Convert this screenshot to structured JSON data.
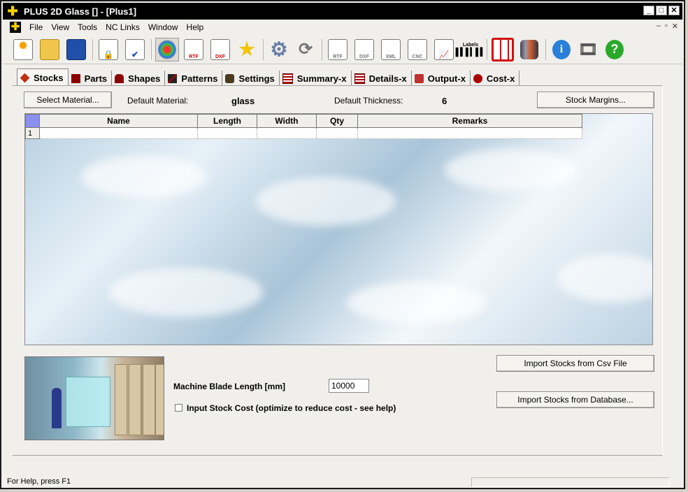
{
  "window": {
    "title": "PLUS 2D Glass [] - [Plus1]",
    "buttons": {
      "minimize": "_",
      "maximize": "□",
      "close": "✕"
    }
  },
  "menubar": {
    "items": [
      "File",
      "View",
      "Tools",
      "NC Links",
      "Window",
      "Help"
    ],
    "mdi": {
      "minimize": "–",
      "restore": "▫",
      "close": "✕"
    }
  },
  "toolbar": {
    "buttons": [
      "new",
      "open",
      "save",
      "lock",
      "checklist",
      "palette",
      "rtf",
      "dxf",
      "star",
      "gear",
      "reload",
      "rtf-export",
      "dxf-export",
      "xml-export",
      "cnc-export",
      "chart",
      "labels",
      "layout",
      "cylinder",
      "info",
      "film",
      "help"
    ],
    "text": {
      "rtf": "RTF",
      "dxf": "DXF",
      "xml": "XML",
      "cnc": "CNC",
      "labels": "Labels",
      "help": "?"
    }
  },
  "tabs": [
    "Stocks",
    "Parts",
    "Shapes",
    "Patterns",
    "Settings",
    "Summary-x",
    "Details-x",
    "Output-x",
    "Cost-x"
  ],
  "stocks": {
    "select_material_button": "Select Material...",
    "default_material_label": "Default Material:",
    "default_material_value": "glass",
    "default_thickness_label": "Default Thickness:",
    "default_thickness_value": "6",
    "stock_margins_button": "Stock Margins...",
    "grid": {
      "columns": [
        "Name",
        "Length",
        "Width",
        "Qty",
        "Remarks"
      ],
      "rows": [
        [
          "1",
          "",
          "",
          "",
          "",
          ""
        ]
      ]
    },
    "machine_blade_label": "Machine Blade Length [mm]",
    "machine_blade_value": "10000",
    "input_stock_cost_label": "Input Stock Cost (optimize to reduce cost - see help)",
    "import_csv_button": "Import Stocks from Csv File",
    "import_db_button": "Import Stocks from Database..."
  },
  "status": {
    "text": "For Help, press F1"
  },
  "colors": {
    "titlebar": "#000000",
    "accent": "#f5d000",
    "corner": "#8a8ff0"
  }
}
